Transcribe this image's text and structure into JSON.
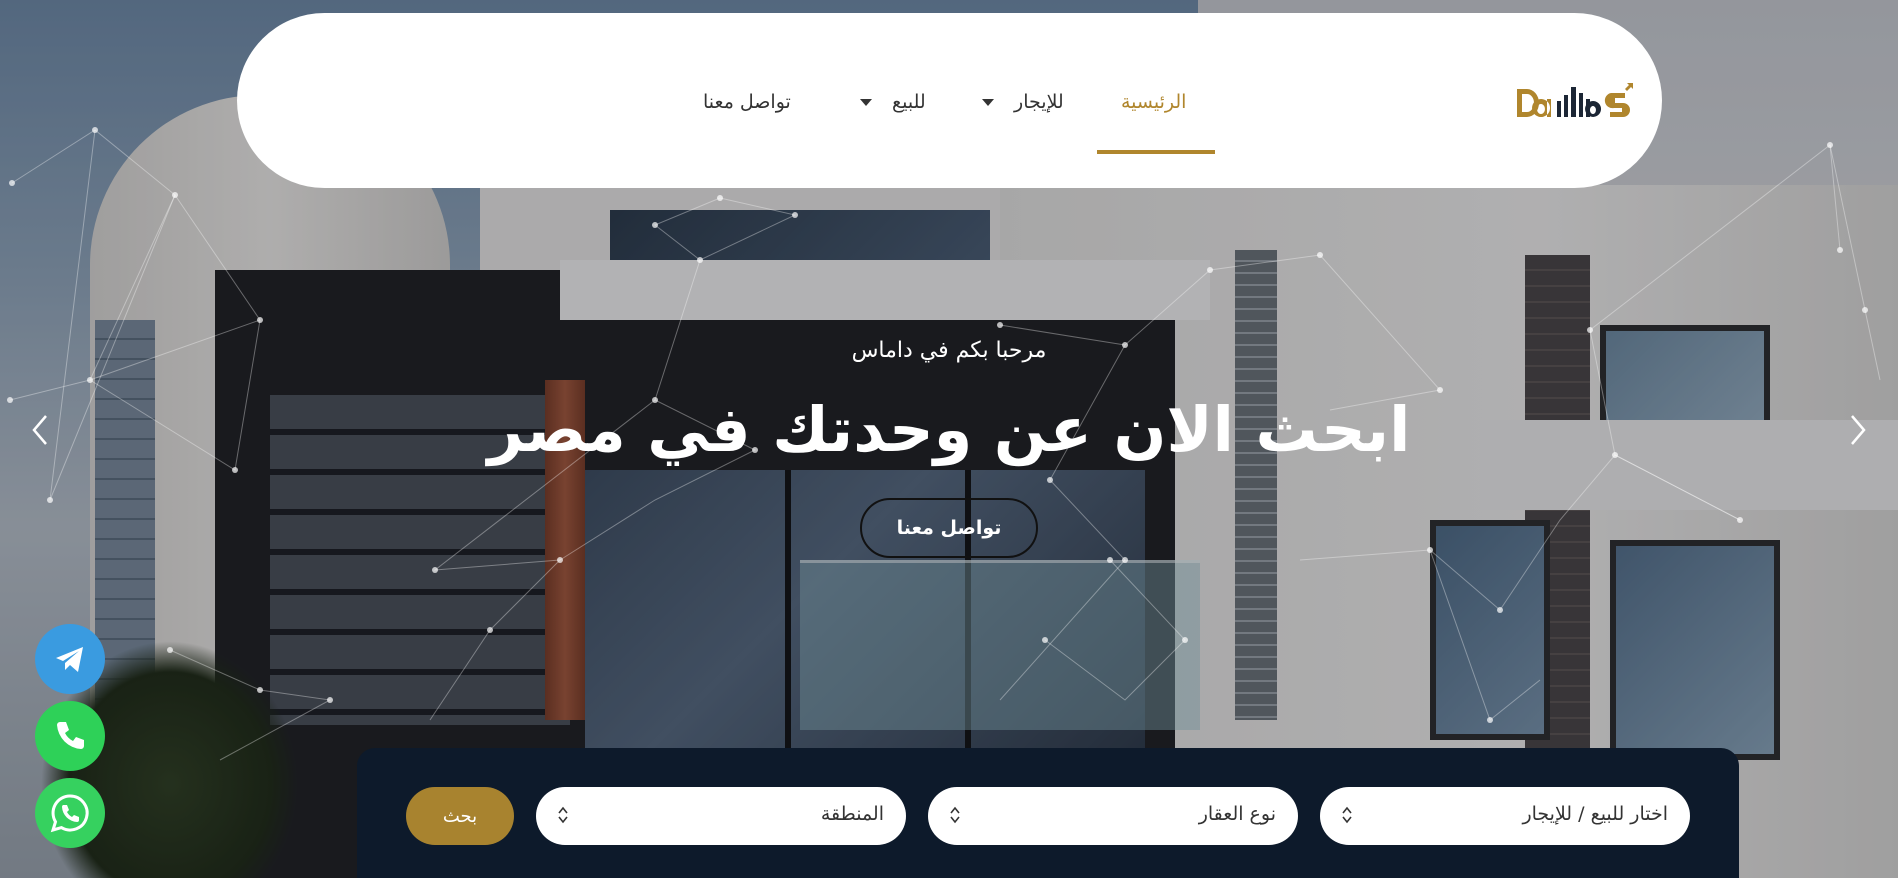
{
  "brand": {
    "logo_text": "DamaS",
    "accent": "#b0862d"
  },
  "nav": {
    "items": [
      {
        "label": "الرئيسية",
        "active": true
      },
      {
        "label": "للإيجار",
        "has_dropdown": true
      },
      {
        "label": "للبيع",
        "has_dropdown": true
      },
      {
        "label": "تواصل معنا"
      }
    ]
  },
  "hero": {
    "subtitle": "مرحبا بكم في داماس",
    "title": "ابحث الان عن وحدتك في مصر",
    "cta_label": "تواصل معنا"
  },
  "carousel": {
    "prev_icon": "chevron-left-icon",
    "next_icon": "chevron-right-icon"
  },
  "floating": {
    "telegram_color": "#3a9be0",
    "phone_color": "#2ed158",
    "whatsapp_color": "#36d15f"
  },
  "search": {
    "listing_type_placeholder": "اختار للبيع / للإيجار",
    "property_type_placeholder": "نوع العقار",
    "region_placeholder": "المنطقة",
    "submit_label": "بحث"
  }
}
